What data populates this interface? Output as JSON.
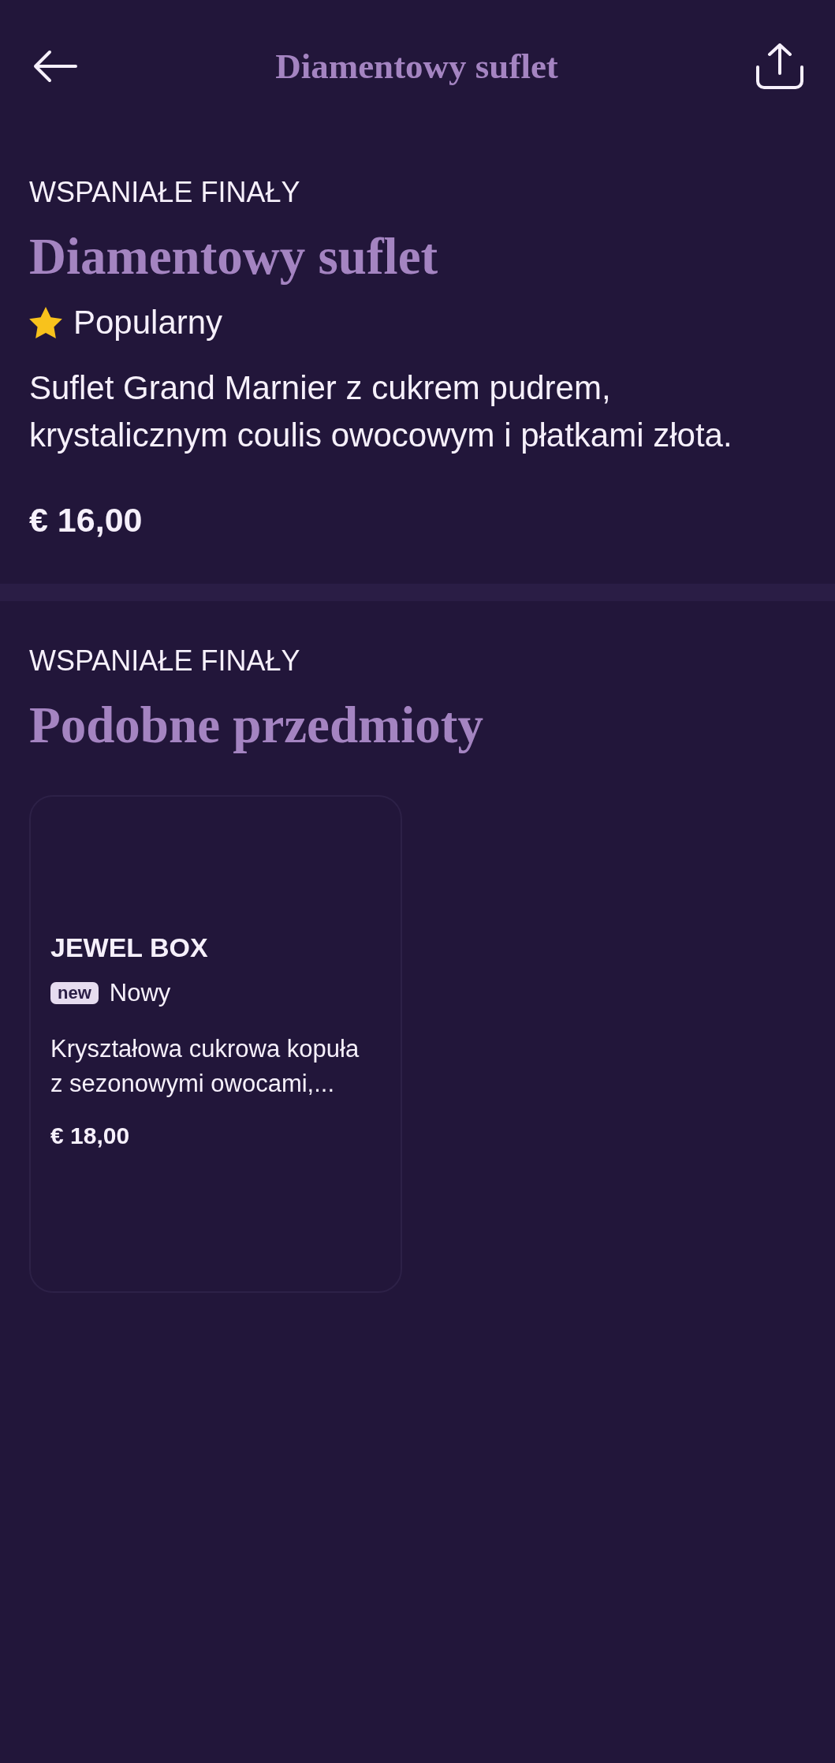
{
  "header": {
    "title": "Diamentowy suflet"
  },
  "item": {
    "category": "WSPANIAŁE FINAŁY",
    "name": "Diamentowy suflet",
    "badge": {
      "kind": "popular",
      "label": "Popularny"
    },
    "description": "Suflet Grand Marnier z cukrem pudrem, krystalicznym coulis owocowym i płatkami złota.",
    "price": "€ 16,00"
  },
  "similar": {
    "category": "WSPANIAŁE FINAŁY",
    "title": "Podobne przedmioty",
    "items": [
      {
        "name": "JEWEL BOX",
        "badge": {
          "kind": "new",
          "tag": "new",
          "label": "Nowy"
        },
        "description": "Kryształowa cukrowa kopuła z sezonowymi owocami,...",
        "price": "€ 18,00"
      }
    ]
  }
}
